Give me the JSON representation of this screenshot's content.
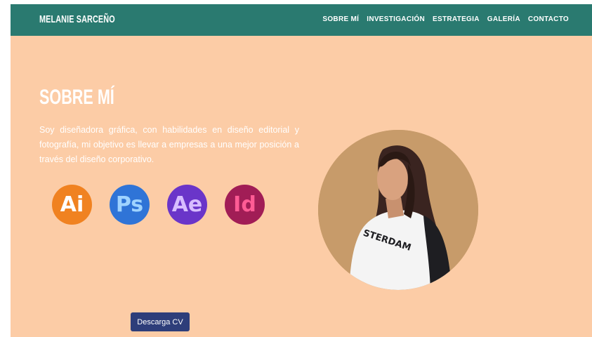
{
  "navbar": {
    "brand": "MELANIE SARCEÑO",
    "links": [
      "SOBRE MÍ",
      "INVESTIGACIÓN",
      "ESTRATEGIA",
      "GALERÍA",
      "CONTACTO"
    ]
  },
  "about": {
    "title": "SOBRE MÍ",
    "text": "Soy diseñadora gráfica, con habilidades en diseño editorial y fotografía, mi objetivo es llevar a empresas a una mejor posición a través del diseño corporativo."
  },
  "skills": [
    {
      "label": "Ai",
      "icon": "adobe-illustrator-icon",
      "color": "#f08221"
    },
    {
      "label": "Ps",
      "icon": "adobe-photoshop-icon",
      "color": "#2f74d7"
    },
    {
      "label": "Ae",
      "icon": "adobe-after-effects-icon",
      "color": "#6a35c9"
    },
    {
      "label": "Id",
      "icon": "adobe-indesign-icon",
      "color": "#a11d56"
    }
  ],
  "shirt_text": "STERDAM",
  "download_button": "Descarga CV",
  "colors": {
    "navbar": "#2a7a70",
    "background": "#fccca6",
    "photo_circle": "#c79b6a",
    "button": "#2e3e7a"
  }
}
